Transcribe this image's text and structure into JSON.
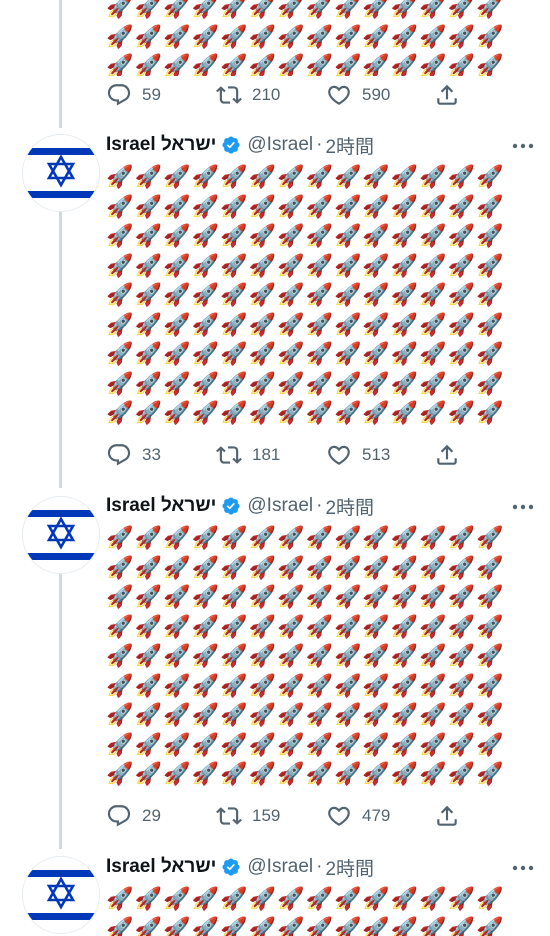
{
  "account": {
    "display_name": "Israel ישראל",
    "handle": "@Israel",
    "separator": "·",
    "time": "2時間",
    "avatar_icon": "star-of-david-icon",
    "verified_icon": "verified-badge-icon",
    "brand_color": "#1d9bf0",
    "israel_blue": "#0038b8"
  },
  "tweet_body_emoji": "🚀",
  "tweets": [
    {
      "replies": "59",
      "retweets": "210",
      "likes": "590"
    },
    {
      "replies": "33",
      "retweets": "181",
      "likes": "513"
    },
    {
      "replies": "29",
      "retweets": "159",
      "likes": "479"
    },
    {
      "replies": "",
      "retweets": "",
      "likes": ""
    }
  ]
}
